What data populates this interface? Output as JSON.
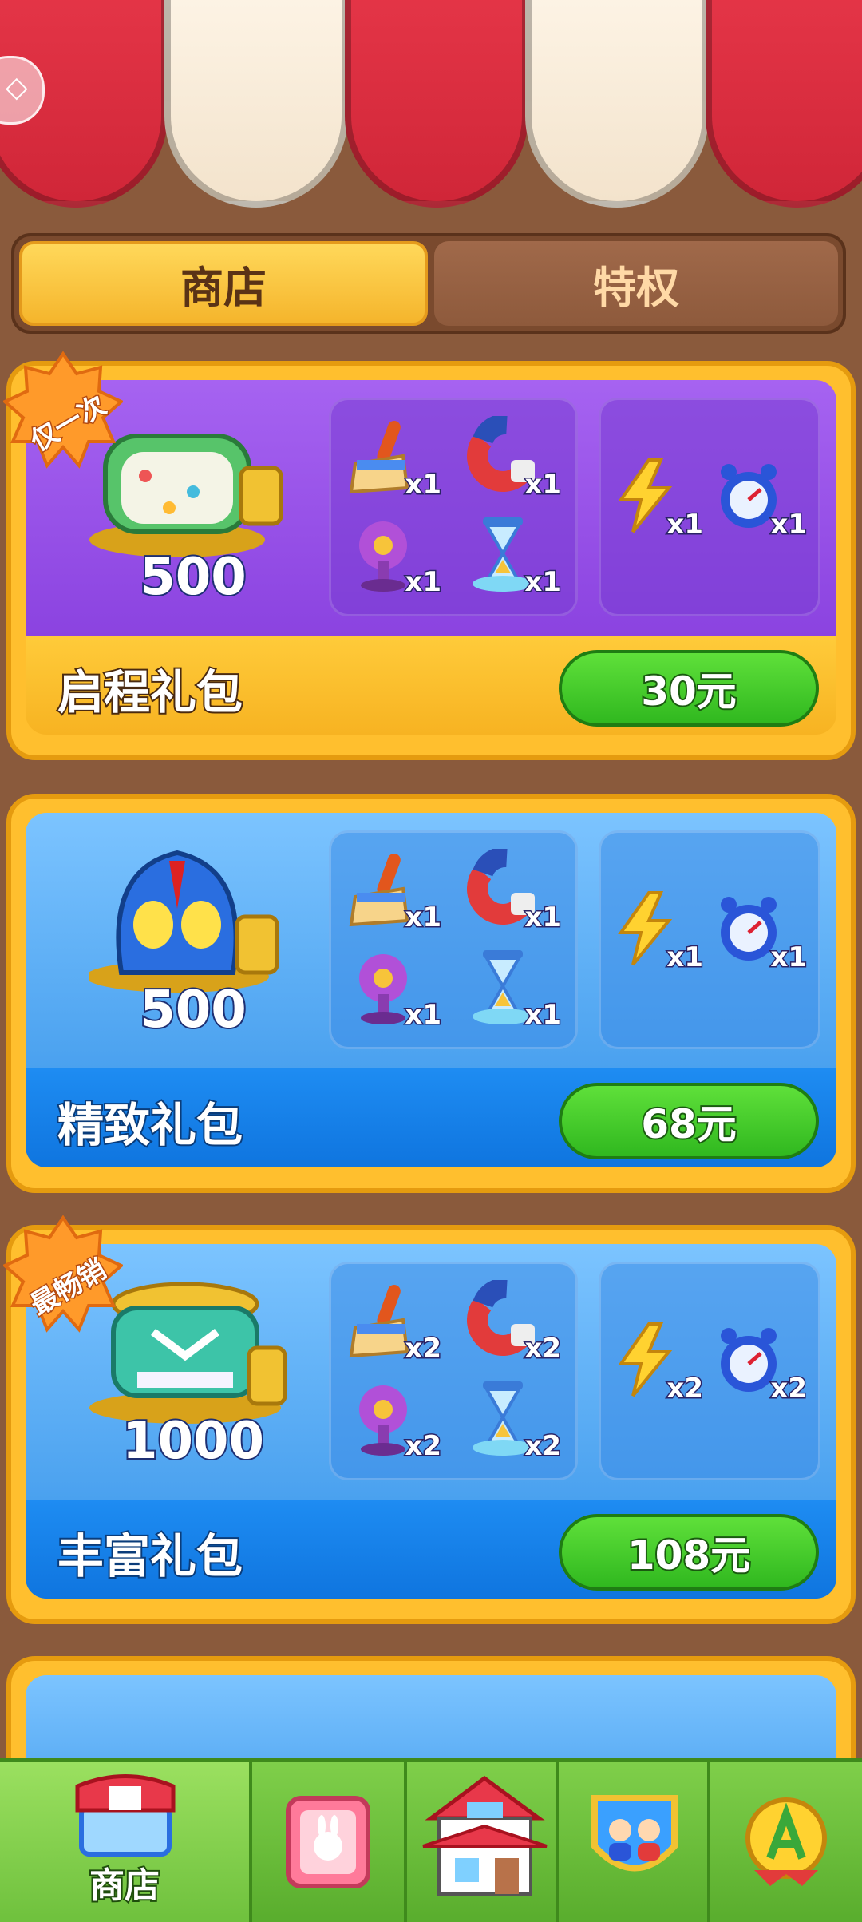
{
  "tabs": {
    "shop": "商店",
    "privilege": "特权"
  },
  "cards": [
    {
      "theme": "purple",
      "badge": "仅一次",
      "coins": "500",
      "items": [
        "x1",
        "x1",
        "x1",
        "x1"
      ],
      "boosts": [
        "x1",
        "x1"
      ],
      "title": "启程礼包",
      "price": "30元"
    },
    {
      "theme": "blue",
      "badge": "",
      "coins": "500",
      "items": [
        "x1",
        "x1",
        "x1",
        "x1"
      ],
      "boosts": [
        "x1",
        "x1"
      ],
      "title": "精致礼包",
      "price": "68元"
    },
    {
      "theme": "blue",
      "badge": "最畅销",
      "coins": "1000",
      "items": [
        "x2",
        "x2",
        "x2",
        "x2"
      ],
      "boosts": [
        "x2",
        "x2"
      ],
      "title": "丰富礼包",
      "price": "108元"
    }
  ],
  "nav": {
    "shop_label": "商店",
    "icons": [
      "shop-icon",
      "album-icon",
      "home-icon",
      "team-icon",
      "profile-icon"
    ]
  },
  "colors": {
    "awning_red": "#e8384a",
    "tab_active": "#f5b52c",
    "price_green": "#30b81f",
    "nav_green": "#59ad2d"
  }
}
